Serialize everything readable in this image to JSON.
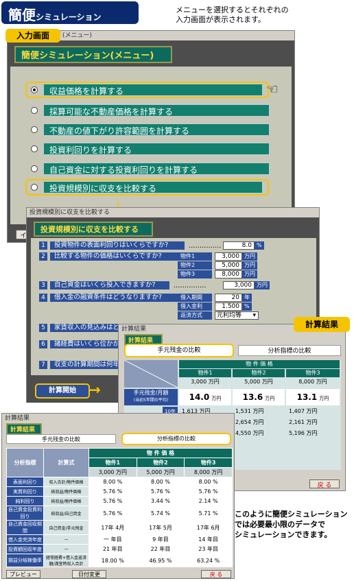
{
  "header": {
    "title_big": "簡便",
    "title_small": "シミュレーション"
  },
  "description": [
    "メニューを選択するとそれぞれの",
    "入力画面が表示されます。"
  ],
  "tags": {
    "input_screen": "入力画面",
    "calc_result": "計算結果"
  },
  "menu": {
    "titlebar": "(メニュー)",
    "title": "簡便シミュレーション(メニュー)",
    "items": [
      "収益価格を計算する",
      "採算可能な不動産価格を計算する",
      "不動産の値下がり許容範囲を計算する",
      "投資利回りを計算する",
      "自己資金に対する投資利回りを計算する",
      "投資規模別に収支を比較する"
    ],
    "partial_button": "イ"
  },
  "compare": {
    "titlebar": "投資規模別に収支を比較する",
    "title": "投資規模別に収支を比較する",
    "q1": {
      "num": "1",
      "text": "投資物件の表面利回りはいくらですか?",
      "dots": "……………",
      "value": "8.0",
      "unit": "%"
    },
    "q2": {
      "num": "2",
      "text": "比較する物件の価格はいくらですか?",
      "rows": [
        {
          "label": "物件1",
          "value": "3,000",
          "unit": "万円"
        },
        {
          "label": "物件2",
          "value": "5,000",
          "unit": "万円"
        },
        {
          "label": "物件3",
          "value": "8,000",
          "unit": "万円"
        }
      ]
    },
    "q3": {
      "num": "3",
      "text": "自己資金はいくら投入できますか?",
      "dots": "……………",
      "value": "3,000",
      "unit": "万円"
    },
    "q4": {
      "num": "4",
      "text": "借入金の融資条件はどうなりますか?",
      "rows": [
        {
          "label": "借入期間",
          "value": "20",
          "unit": "年"
        },
        {
          "label": "借入金利",
          "value": "1.500",
          "unit": "%"
        },
        {
          "label": "返済方式",
          "value": "元利均等"
        }
      ]
    },
    "q5": {
      "num": "5",
      "text": "家賃収入の見込みはど"
    },
    "q6": {
      "num": "6",
      "text": "諸経費はいくら位かか"
    },
    "q7": {
      "num": "7",
      "text": "収支の計算期間は何年"
    },
    "start_button": "計算開始"
  },
  "result_back": {
    "titlebar": "計算結果",
    "title": "計算結果",
    "tabs": [
      "手元残金の比較",
      "分析指標の比較"
    ],
    "col_head": "物 件 価 格",
    "cols": [
      "物件1",
      "物件2",
      "物件3"
    ],
    "prices": [
      "3,000 万円",
      "5,000 万円",
      "8,000 万円"
    ],
    "row_label": "手元残金/月額",
    "row_sub": "(当初5年間の平均)",
    "row_vals": [
      "14.0",
      "13.6",
      "13.1"
    ],
    "row_unit": "万円",
    "rows": [
      {
        "label": "10年間",
        "vals": [
          "1,613 万円",
          "1,531 万円",
          "1,407 万円"
        ]
      },
      {
        "label": "",
        "vals": [
          "",
          "2,654 万円",
          "2,161 万円"
        ]
      },
      {
        "label": "",
        "vals": [
          "",
          "4,550 万円",
          "5,196 万円"
        ]
      }
    ],
    "back_button": "戻 る"
  },
  "result_front": {
    "titlebar": "計算結果",
    "title": "計算結果",
    "tabs": [
      "手元残金の比較",
      "分析指標の比較"
    ],
    "head": {
      "c1": "分析指標",
      "c2": "計算式",
      "c3": "物 件 価 格"
    },
    "cols": [
      "物件1",
      "物件2",
      "物件3"
    ],
    "prices": [
      "3,000 万円",
      "5,000 万円",
      "8,000 万円"
    ],
    "rows": [
      {
        "label": "表面利回り",
        "formula": "収入合計/物件価格",
        "vals": [
          "8.00 %",
          "8.00 %",
          "8.00 %"
        ]
      },
      {
        "label": "実質利回り",
        "formula": "純収益/物件価格",
        "vals": [
          "5.76 %",
          "5.76 %",
          "5.76 %"
        ]
      },
      {
        "label": "純利回り",
        "formula": "純収益/物件価格",
        "vals": [
          "5.76 %",
          "3.44 %",
          "2.14 %"
        ]
      },
      {
        "label": "自己資金投資利回り",
        "formula": "純収益/自己資金",
        "vals": [
          "5.76 %",
          "5.74 %",
          "5.71 %"
        ]
      },
      {
        "label": "自己資金回収期間",
        "formula": "自己資金/手元残金",
        "vals": [
          "17年 4月",
          "17年 5月",
          "17年 6月"
        ]
      },
      {
        "label": "借入金完済年度",
        "formula": "—",
        "vals": [
          "一 年目",
          "9 年目",
          "14 年目"
        ]
      },
      {
        "label": "投資額回収年度",
        "formula": "—",
        "vals": [
          "21 年目",
          "22 年目",
          "23 年目"
        ]
      },
      {
        "label": "損益分岐稼働率",
        "formula": "経常経費+借入金返済額/満室時収入合計",
        "vals": [
          "18.00 %",
          "46.95 %",
          "63.24 %"
        ]
      }
    ],
    "buttons": {
      "preview": "プレビュー",
      "date": "日付変更",
      "back": "戻 る"
    }
  },
  "footer_note": [
    "このように簡便シミュレーション",
    "では必要最小限のデータで",
    "シミュレーションできます。"
  ]
}
